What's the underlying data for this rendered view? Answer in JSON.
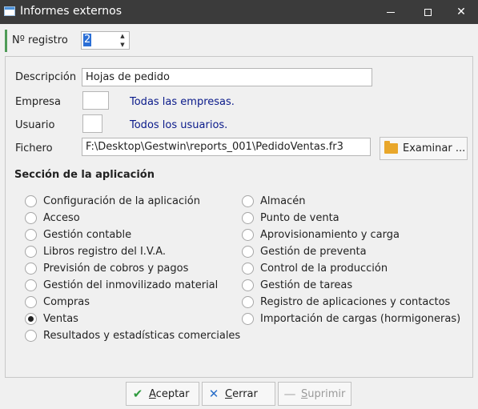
{
  "window": {
    "title": "Informes externos",
    "minimize_glyph": "",
    "close_glyph": "✕"
  },
  "registro": {
    "label": "Nº registro",
    "value": "2"
  },
  "form": {
    "descripcion_label": "Descripción",
    "descripcion_value": "Hojas de pedido",
    "empresa_label": "Empresa",
    "empresa_value": "",
    "empresa_note": "Todas las empresas.",
    "usuario_label": "Usuario",
    "usuario_value": "",
    "usuario_note": "Todos los usuarios.",
    "fichero_label": "Fichero",
    "fichero_value": "F:\\Desktop\\Gestwin\\reports_001\\PedidoVentas.fr3",
    "examinar_label": "Examinar ...",
    "examinar_icon": "folder-icon"
  },
  "section": {
    "title": "Sección de la aplicación",
    "left_options": [
      "Configuración de la aplicación",
      "Acceso",
      "Gestión contable",
      "Libros registro del I.V.A.",
      "Previsión de cobros y pagos",
      "Gestión del inmovilizado material",
      "Compras",
      "Ventas",
      "Resultados y estadísticas comerciales"
    ],
    "right_options": [
      "Almacén",
      "Punto de venta",
      "Aprovisionamiento y carga",
      "Gestión de preventa",
      "Control de la producción",
      "Gestión de tareas",
      "Registro de aplicaciones y contactos",
      "Importación de cargas (hormigoneras)"
    ],
    "selected": "Ventas"
  },
  "buttons": {
    "aceptar_first": "A",
    "aceptar_rest": "ceptar",
    "cerrar_first": "C",
    "cerrar_rest": "errar",
    "suprimir_first": "S",
    "suprimir_rest": "uprimir",
    "aceptar_icon": "✔",
    "cerrar_icon": "✕",
    "suprimir_icon": "—"
  },
  "colors": {
    "titlebar": "#3b3b3b",
    "accent": "#4f9b57",
    "note_text": "#0a1a8a",
    "selection": "#2b6fd6"
  }
}
